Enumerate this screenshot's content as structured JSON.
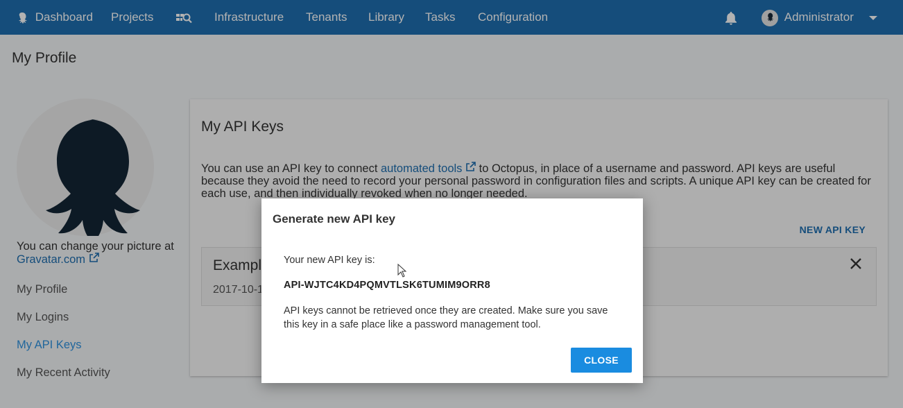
{
  "nav": {
    "dashboard": "Dashboard",
    "projects": "Projects",
    "infrastructure": "Infrastructure",
    "tenants": "Tenants",
    "library": "Library",
    "tasks": "Tasks",
    "configuration": "Configuration",
    "user": "Administrator"
  },
  "page": {
    "title": "My Profile"
  },
  "sidebar": {
    "picture_text": "You can change your picture at",
    "gravatar_link": "Gravatar.com",
    "items": [
      {
        "label": "My Profile"
      },
      {
        "label": "My Logins"
      },
      {
        "label": "My API Keys"
      },
      {
        "label": "My Recent Activity"
      }
    ]
  },
  "main": {
    "title": "My API Keys",
    "desc_before": "You can use an API key to connect",
    "desc_link": "automated tools",
    "desc_after": "to Octopus, in place of a username and password. API keys are useful because they avoid the need to record your personal password in configuration files and scripts. A unique API key can be created for each use, and then individually revoked when no longer needed.",
    "new_key_label": "NEW API KEY",
    "key_item": {
      "name": "Example",
      "date": "2017-10-1"
    }
  },
  "dialog": {
    "title": "Generate new API key",
    "label": "Your new API key is:",
    "api_key": "API-WJTC4KD4PQMVTLSK6TUMIM9ORR8",
    "note": "API keys cannot be retrieved once they are created. Make sure you save this key in a safe place like a password management tool.",
    "close_label": "CLOSE"
  },
  "colors": {
    "nav_bg": "#1f6fb0",
    "accent": "#1a8ce0",
    "link": "#1f6fb0",
    "active_sidebar": "#2f93e0"
  },
  "icons": [
    "octopus-logo-icon",
    "project-groups-icon",
    "bell-icon",
    "user-avatar-icon",
    "caret-down-icon",
    "external-link-icon",
    "close-icon"
  ]
}
